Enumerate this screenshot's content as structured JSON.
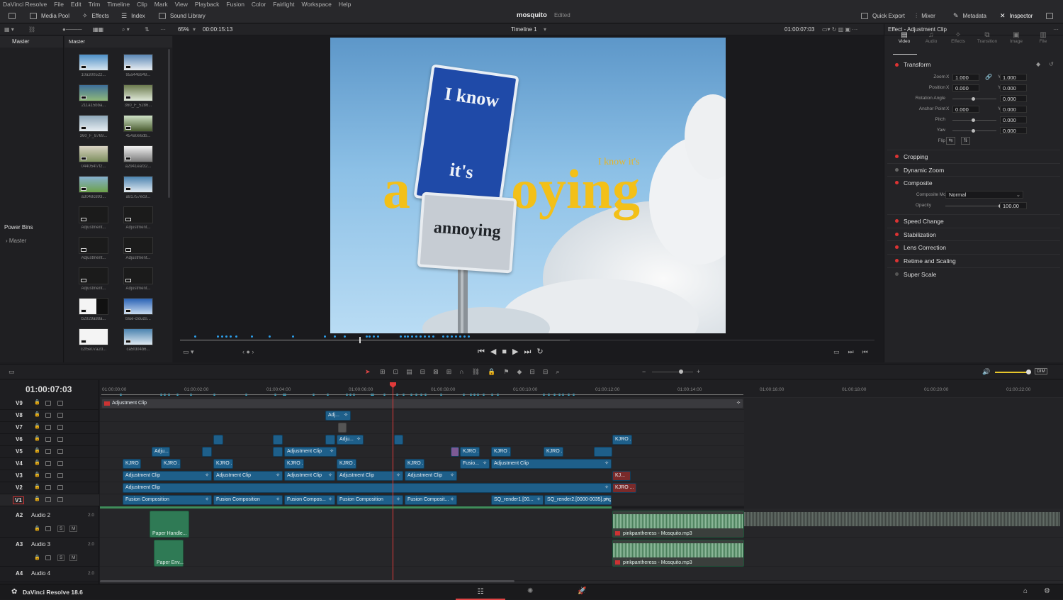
{
  "app": {
    "name": "DaVinci Resolve",
    "status_name": "DaVinci Resolve 18.6"
  },
  "menu": [
    "DaVinci Resolve",
    "File",
    "Edit",
    "Trim",
    "Timeline",
    "Clip",
    "Mark",
    "View",
    "Playback",
    "Fusion",
    "Color",
    "Fairlight",
    "Workspace",
    "Help"
  ],
  "topbar": {
    "media_pool": "Media Pool",
    "effects": "Effects",
    "index": "Index",
    "sound_library": "Sound Library",
    "project": "mosquito",
    "project_status": "Edited",
    "quick_export": "Quick Export",
    "mixer": "Mixer",
    "metadata": "Metadata",
    "inspector": "Inspector"
  },
  "viewer": {
    "zoom": "65%",
    "src_tc": "00:00:15:13",
    "timeline_name": "Timeline 1",
    "rec_tc": "01:00:07:03"
  },
  "bins": {
    "header": "Master",
    "power_bins": "Power Bins",
    "power_master": "Master"
  },
  "clips": {
    "header": "Master",
    "items": [
      "10a300522...",
      "95a446949...",
      "211a15bba...",
      "360_F_5286...",
      "360_F_8769...",
      "454a0e6db...",
      "044054f7f2...",
      "a2941eaf32...",
      "a3048c893...",
      "a81757ec9...",
      "Adjustment...",
      "Adjustment...",
      "Adjustment...",
      "Adjustment...",
      "Adjustment...",
      "Adjustment...",
      "b2929a88a...",
      "blue-clouds...",
      "c2f5e07a2d...",
      "ca5fd04b6..."
    ]
  },
  "frame_text": {
    "sign_top_1": "I know",
    "sign_top_2": "it's",
    "sign_bottom": "annoying",
    "overlay_big_1": "a",
    "overlay_big_2": "oying",
    "overlay_small": "I know it's"
  },
  "inspector": {
    "title": "Effect - Adjustment Clip",
    "tabs": [
      "Video",
      "Audio",
      "Effects",
      "Transition",
      "Image",
      "File"
    ],
    "transform": "Transform",
    "zoom_label": "Zoom",
    "zoom_x": "1.000",
    "zoom_y": "1.000",
    "position_label": "Position",
    "pos_x": "0.000",
    "pos_y": "0.000",
    "rotation_label": "Rotation Angle",
    "rotation": "0.000",
    "anchor_label": "Anchor Point",
    "anchor_x": "0.000",
    "anchor_y": "0.000",
    "pitch_label": "Pitch",
    "pitch": "0.000",
    "yaw_label": "Yaw",
    "yaw": "0.000",
    "flip_label": "Flip",
    "x": "X",
    "y": "Y",
    "cropping": "Cropping",
    "dynamic_zoom": "Dynamic Zoom",
    "composite": "Composite",
    "composite_mode_label": "Composite Mode",
    "composite_mode": "Normal",
    "opacity_label": "Opacity",
    "opacity": "100.00",
    "speed_change": "Speed Change",
    "stabilization": "Stabilization",
    "lens_correction": "Lens Correction",
    "retime": "Retime and Scaling",
    "super_scale": "Super Scale"
  },
  "timeline": {
    "timecode": "01:00:07:03",
    "ruler": [
      "01:00:00:00",
      "01:00:02:00",
      "01:00:04:00",
      "01:00:06:00",
      "01:00:08:00",
      "01:00:10:00",
      "01:00:12:00",
      "01:00:14:00",
      "01:00:16:00",
      "01:00:18:00",
      "01:00:20:00",
      "01:00:22:00"
    ],
    "tracks": [
      "V9",
      "V8",
      "V7",
      "V6",
      "V5",
      "V4",
      "V3",
      "V2",
      "V1"
    ],
    "audio_tracks": [
      {
        "id": "A2",
        "name": "Audio 2",
        "ch": "2.0"
      },
      {
        "id": "A3",
        "name": "Audio 3",
        "ch": "2.0"
      },
      {
        "id": "A4",
        "name": "Audio 4",
        "ch": "2.0"
      }
    ],
    "clip_labels": {
      "adj": "Adjustment Clip",
      "adj_short": "Adju...",
      "adj_short2": "Adj...",
      "kjro": "KJRO ...",
      "fusion": "Fusion Composition",
      "fusion_short": "Fusion Compos...",
      "fusion_short2": "Fusion Composit...",
      "fusio": "Fusio...",
      "sq1": "SQ_render1.[00...",
      "sq2": "SQ_render2.[0000-0035].png",
      "kj": "KJ...",
      "paper1": "Paper Handle...",
      "paper2": "Paper Env...",
      "mosquito": "pinkpantheress - Mosquito.mp3",
      "s": "S",
      "m": "M"
    }
  }
}
